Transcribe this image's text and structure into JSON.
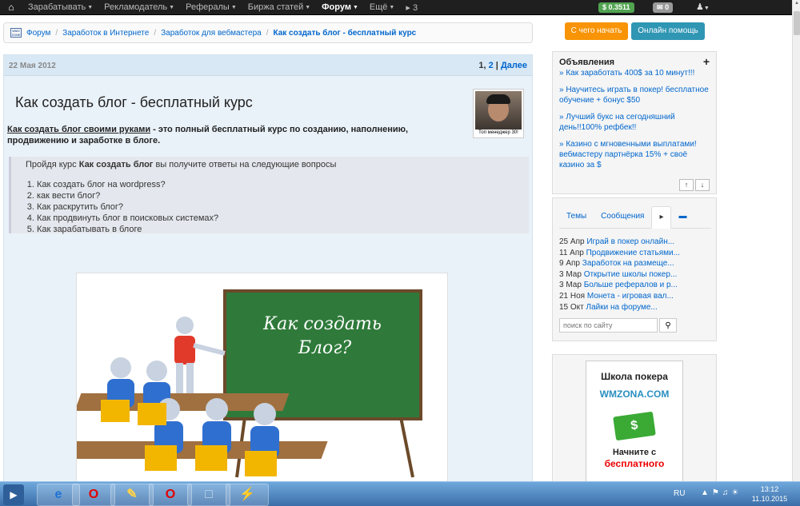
{
  "nav": {
    "items": [
      {
        "label": "Зарабатывать",
        "dropdown": true
      },
      {
        "label": "Рекламодатель",
        "dropdown": true
      },
      {
        "label": "Рефералы",
        "dropdown": true
      },
      {
        "label": "Биржа статей",
        "dropdown": true
      },
      {
        "label": "Форум",
        "dropdown": true,
        "active": true
      },
      {
        "label": "Ещё",
        "dropdown": true
      }
    ],
    "notify_count": "3",
    "balance": "$ 0.3511",
    "mail_count": "0"
  },
  "breadcrumb": [
    "Форум",
    "Заработок в Интернете",
    "Заработок для вебмастера",
    "Как создать блог - бесплатный курс"
  ],
  "post": {
    "date": "22 Мая 2012",
    "pages": [
      "1",
      "2"
    ],
    "next": "Далее",
    "title": "Как создать блог - бесплатный курс",
    "avatar_caption": "Топ менеджер 30!",
    "intro_link": "Как создать блог своими руками",
    "intro_text": " - это полный бесплатный курс по созданию, наполнению, продвижению и заработке в блоге.",
    "quote_lead": "Пройдя курс ",
    "quote_bold": "Как создать блог",
    "quote_tail": " вы получите ответы на следующие вопросы",
    "questions": [
      "Как создать блог на wordpress?",
      "как вести блог?",
      "Как раскрутить блог?",
      "Как продвинуть блог в поисковых системах?",
      "Как зарабатывать в блоге"
    ],
    "image_text_line1": "Как создать",
    "image_text_line2": "Блог?"
  },
  "sidebar": {
    "start_button": "С чего начать",
    "help_button": "Онлайн помощь",
    "ads_title": "Объявления",
    "ads": [
      "» Как заработать 400$ за 10 минут!!!",
      "» Научитесь играть в покер! бесплатное обучение + бонус $50",
      "» Лучший букс на сегодняшний день!!100% рефбек!!",
      "» Казино с мгновенными выплатами! вебмастеру партнёрка 15% + своё казино за $"
    ],
    "tabs": [
      "Темы",
      "Сообщения"
    ],
    "feed": [
      {
        "date": "25 Апр",
        "title": "Играй в покер онлайн..."
      },
      {
        "date": "11 Апр",
        "title": "Продвижение статьями..."
      },
      {
        "date": "9 Апр",
        "title": "Заработок на размеще..."
      },
      {
        "date": "3 Мар",
        "title": "Открытие школы покер..."
      },
      {
        "date": "3 Мар",
        "title": "Больше рефералов и р..."
      },
      {
        "date": "21 Ноя",
        "title": "Монета - игровая вал..."
      },
      {
        "date": "15 Окт",
        "title": "Лайки на форуме..."
      }
    ],
    "search_placeholder": "поиск по сайту",
    "banner": {
      "line1": "Школа покера",
      "line2": "WMZONA.COM",
      "line3": "Начните с",
      "line4": "бесплатного"
    }
  },
  "taskbar": {
    "lang": "RU",
    "time": "13:12",
    "date": "11.10.2015"
  }
}
